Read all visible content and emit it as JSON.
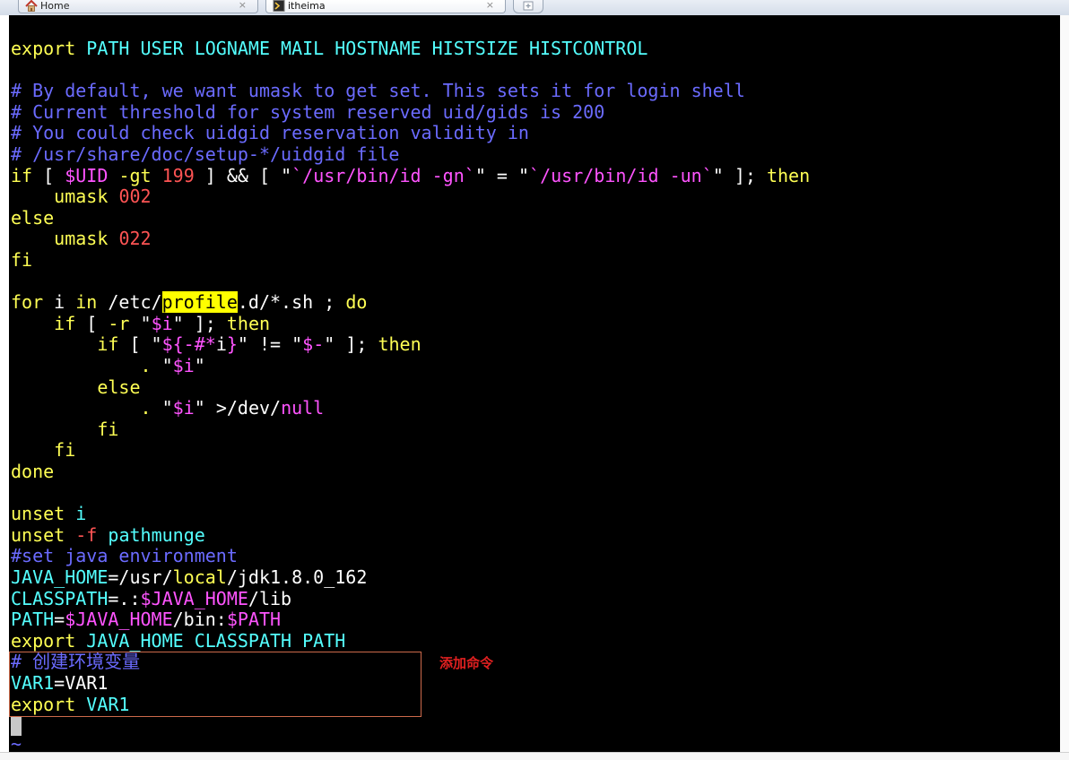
{
  "tabs": [
    {
      "label": "Home",
      "close": "×"
    },
    {
      "label": "itheima",
      "close": "×"
    }
  ],
  "colors": {
    "keyword": "#ffff54",
    "builtin": "#54ffff",
    "comment": "#6b6bff",
    "number": "#ff5454",
    "string": "#ff54ff",
    "highlight": "#ffff00",
    "annotation": "#e02020"
  },
  "terminal": {
    "lines": [
      [
        [
          "y",
          "export"
        ],
        [
          "w",
          " "
        ],
        [
          "c",
          "PATH USER LOGNAME MAIL HOSTNAME HISTSIZE HISTCONTROL"
        ]
      ],
      [],
      [
        [
          "b",
          "# By default, we want umask to get set. This sets it for login shell"
        ]
      ],
      [
        [
          "b",
          "# Current threshold for system reserved uid/gids is 200"
        ]
      ],
      [
        [
          "b",
          "# You could check uidgid reservation validity in"
        ]
      ],
      [
        [
          "b",
          "# /usr/share/doc/setup-*/uidgid file"
        ]
      ],
      [
        [
          "y",
          "if"
        ],
        [
          "w",
          " [ "
        ],
        [
          "m",
          "$UID"
        ],
        [
          "w",
          " "
        ],
        [
          "y",
          "-gt"
        ],
        [
          "w",
          " "
        ],
        [
          "r",
          "199"
        ],
        [
          "w",
          " ] && [ \""
        ],
        [
          "m",
          "`/usr/bin/id -gn`"
        ],
        [
          "w",
          "\" = \""
        ],
        [
          "m",
          "`/usr/bin/id -un`"
        ],
        [
          "w",
          "\" ]; "
        ],
        [
          "y",
          "then"
        ]
      ],
      [
        [
          "w",
          "    "
        ],
        [
          "y",
          "umask"
        ],
        [
          "w",
          " "
        ],
        [
          "r",
          "002"
        ]
      ],
      [
        [
          "y",
          "else"
        ]
      ],
      [
        [
          "w",
          "    "
        ],
        [
          "y",
          "umask"
        ],
        [
          "w",
          " "
        ],
        [
          "r",
          "022"
        ]
      ],
      [
        [
          "y",
          "fi"
        ]
      ],
      [],
      [
        [
          "y",
          "for"
        ],
        [
          "w",
          " i "
        ],
        [
          "y",
          "in"
        ],
        [
          "w",
          " /etc/"
        ],
        [
          "hl",
          "profile"
        ],
        [
          "w",
          ".d/*.sh ; "
        ],
        [
          "y",
          "do"
        ]
      ],
      [
        [
          "w",
          "    "
        ],
        [
          "y",
          "if"
        ],
        [
          "w",
          " [ "
        ],
        [
          "y",
          "-r"
        ],
        [
          "w",
          " \""
        ],
        [
          "m",
          "$i"
        ],
        [
          "w",
          "\" ]; "
        ],
        [
          "y",
          "then"
        ]
      ],
      [
        [
          "w",
          "        "
        ],
        [
          "y",
          "if"
        ],
        [
          "w",
          " [ \""
        ],
        [
          "m",
          "${-#*"
        ],
        [
          "w",
          "i"
        ],
        [
          "m",
          "}"
        ],
        [
          "w",
          "\" != \""
        ],
        [
          "m",
          "$-"
        ],
        [
          "w",
          "\" ]; "
        ],
        [
          "y",
          "then"
        ]
      ],
      [
        [
          "w",
          "            "
        ],
        [
          "y",
          "."
        ],
        [
          "w",
          " \""
        ],
        [
          "m",
          "$i"
        ],
        [
          "w",
          "\""
        ]
      ],
      [
        [
          "w",
          "        "
        ],
        [
          "y",
          "else"
        ]
      ],
      [
        [
          "w",
          "            "
        ],
        [
          "y",
          "."
        ],
        [
          "w",
          " \""
        ],
        [
          "m",
          "$i"
        ],
        [
          "w",
          "\" >/dev/"
        ],
        [
          "m",
          "null"
        ]
      ],
      [
        [
          "w",
          "        "
        ],
        [
          "y",
          "fi"
        ]
      ],
      [
        [
          "w",
          "    "
        ],
        [
          "y",
          "fi"
        ]
      ],
      [
        [
          "y",
          "done"
        ]
      ],
      [],
      [
        [
          "y",
          "unset"
        ],
        [
          "w",
          " "
        ],
        [
          "c",
          "i"
        ]
      ],
      [
        [
          "y",
          "unset"
        ],
        [
          "w",
          " "
        ],
        [
          "r",
          "-f"
        ],
        [
          "w",
          " "
        ],
        [
          "c",
          "pathmunge"
        ]
      ],
      [
        [
          "b",
          "#set java environment"
        ]
      ],
      [
        [
          "c",
          "JAVA_HOME"
        ],
        [
          "w",
          "=/usr/"
        ],
        [
          "y",
          "local"
        ],
        [
          "w",
          "/jdk1.8.0_162"
        ]
      ],
      [
        [
          "c",
          "CLASSPATH"
        ],
        [
          "w",
          "=.:"
        ],
        [
          "m",
          "$JAVA_HOME"
        ],
        [
          "w",
          "/lib"
        ]
      ],
      [
        [
          "c",
          "PATH"
        ],
        [
          "w",
          "="
        ],
        [
          "m",
          "$JAVA_HOME"
        ],
        [
          "w",
          "/bin:"
        ],
        [
          "m",
          "$PATH"
        ]
      ],
      [
        [
          "y",
          "export"
        ],
        [
          "w",
          " "
        ],
        [
          "c",
          "JAVA_HOME CLASSPATH PATH"
        ]
      ],
      [
        [
          "b",
          "# 创建环境变量"
        ]
      ],
      [
        [
          "c",
          "VAR1"
        ],
        [
          "w",
          "=VAR1"
        ]
      ],
      [
        [
          "y",
          "export"
        ],
        [
          "w",
          " "
        ],
        [
          "c",
          "VAR1"
        ]
      ]
    ],
    "tilde": "~"
  },
  "annotation": {
    "label": "添加命令"
  }
}
